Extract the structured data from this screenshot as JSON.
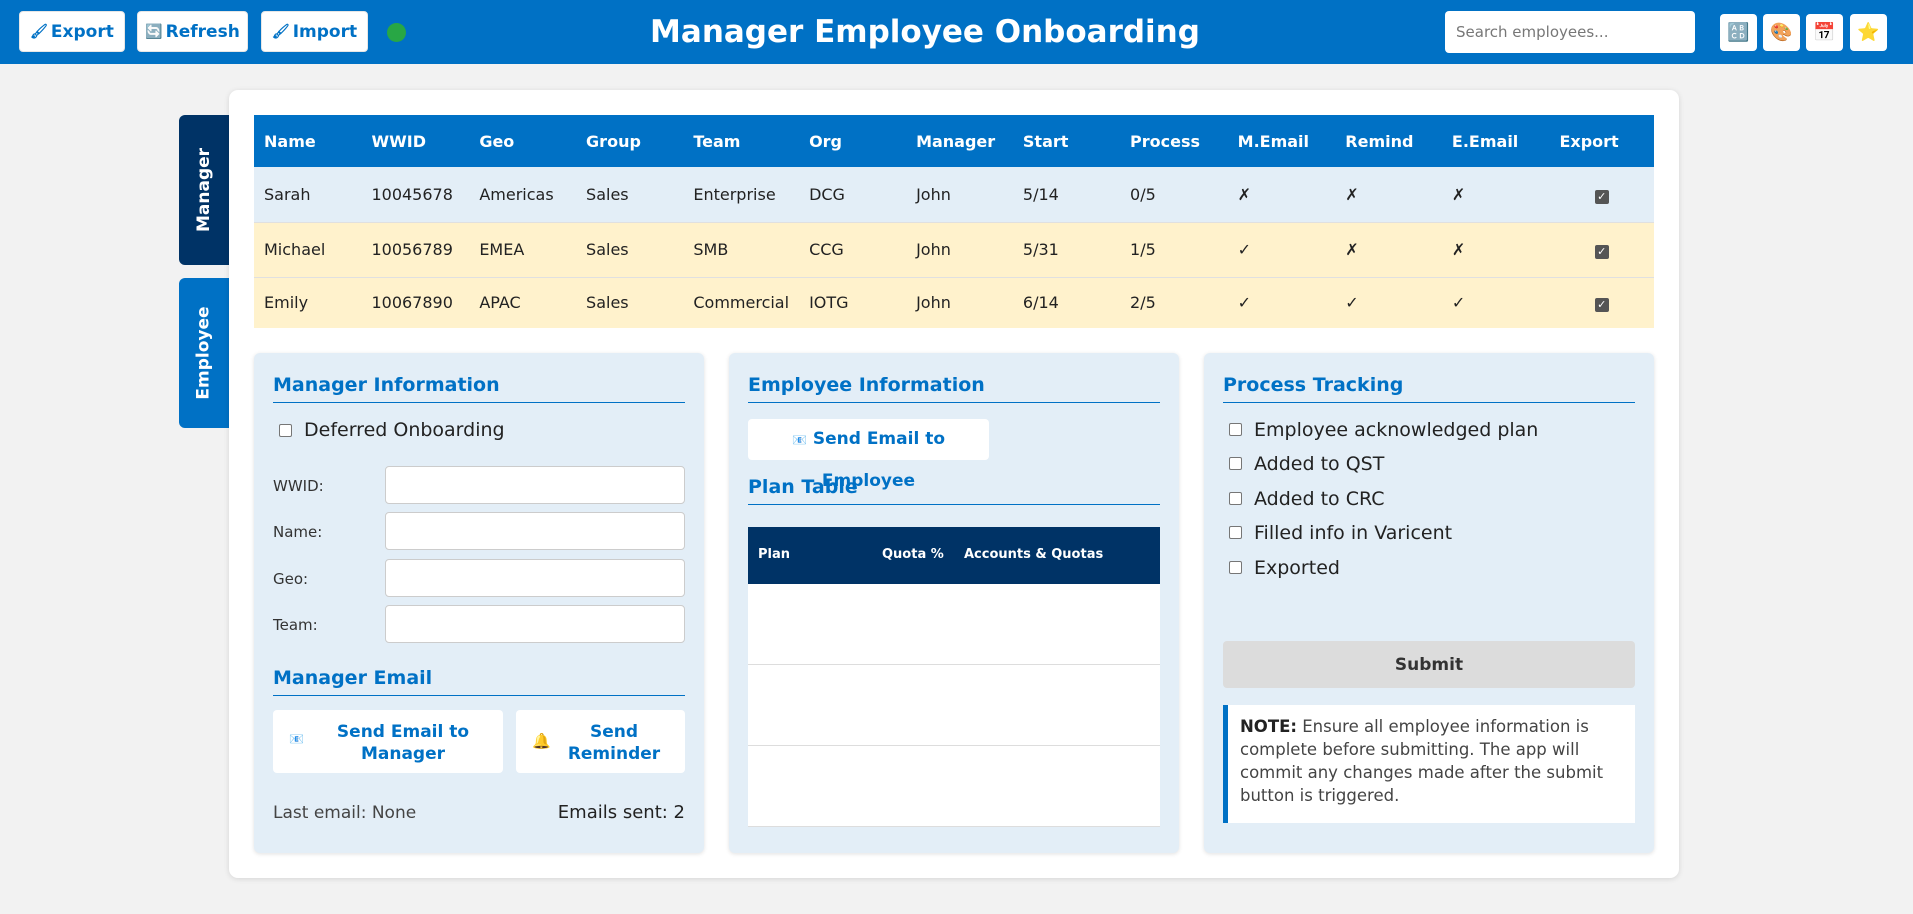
{
  "header": {
    "title": "Manager Employee Onboarding",
    "buttons": [
      {
        "label": "Export",
        "icon": "export-icon"
      },
      {
        "label": "Refresh",
        "icon": "refresh-icon"
      },
      {
        "label": "Import",
        "icon": "import-icon"
      }
    ],
    "status_color": "#28a745",
    "search_placeholder": "Search employees...",
    "icon_buttons": [
      "grid-icon",
      "palette-icon",
      "calendar-icon",
      "star-icon"
    ]
  },
  "side_tabs": [
    {
      "label": "Manager",
      "active": true
    },
    {
      "label": "Employee",
      "active": false
    }
  ],
  "table": {
    "columns": [
      "Name",
      "WWID",
      "Geo",
      "Group",
      "Team",
      "Org",
      "Manager",
      "Start",
      "Process",
      "M.Email",
      "Remind",
      "E.Email",
      "Export"
    ],
    "rows": [
      {
        "name": "Sarah",
        "wwid": "10045678",
        "geo": "Americas",
        "group": "Sales",
        "team": "Enterprise",
        "org": "DCG",
        "manager": "John",
        "start": "5/14",
        "process": "0/5",
        "m_email": "✗",
        "remind": "✗",
        "e_email": "✗",
        "export": true
      },
      {
        "name": "Michael",
        "wwid": "10056789",
        "geo": "EMEA",
        "group": "Sales",
        "team": "SMB",
        "org": "CCG",
        "manager": "John",
        "start": "5/31",
        "process": "1/5",
        "m_email": "✓",
        "remind": "✗",
        "e_email": "✗",
        "export": true
      },
      {
        "name": "Emily",
        "wwid": "10067890",
        "geo": "APAC",
        "group": "Sales",
        "team": "Commercial",
        "org": "IOTG",
        "manager": "John",
        "start": "6/14",
        "process": "2/5",
        "m_email": "✓",
        "remind": "✓",
        "e_email": "✓",
        "export": true
      }
    ]
  },
  "manager_panel": {
    "title": "Manager Information",
    "deferred_label": "Deferred Onboarding",
    "fields": [
      {
        "label": "WWID:",
        "value": ""
      },
      {
        "label": "Name:",
        "value": ""
      },
      {
        "label": "Geo:",
        "value": ""
      },
      {
        "label": "Team:",
        "value": ""
      }
    ],
    "email_title": "Manager Email",
    "send_email_label": "Send Email to Manager",
    "send_reminder_label": "Send Reminder",
    "last_email": "Last email: None",
    "emails_sent": "Emails sent: 2"
  },
  "employee_panel": {
    "title": "Employee Information",
    "send_email_label": "Send Email to Employee",
    "plan_title": "Plan Table",
    "plan_columns": [
      "Plan",
      "Quota %",
      "Accounts & Quotas"
    ]
  },
  "process_panel": {
    "title": "Process Tracking",
    "items": [
      "Employee acknowledged plan",
      "Added to QST",
      "Added to CRC",
      "Filled info in Varicent",
      "Exported"
    ],
    "submit_label": "Submit",
    "note_bold": "NOTE:",
    "note_text": "Ensure all employee information is complete before submitting. The app will commit any changes made after the submit button is triggered."
  }
}
